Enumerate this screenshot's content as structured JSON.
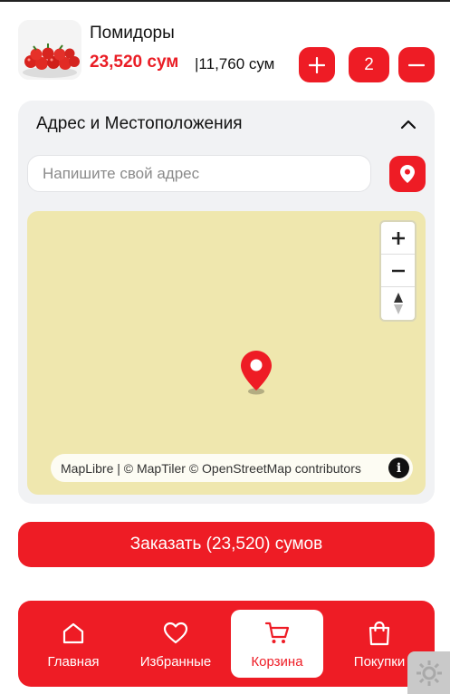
{
  "product": {
    "name": "Помидоры",
    "price": "23,520 сум",
    "unit_price": "|11,760 сум",
    "quantity": "2",
    "plus_icon": "plus-icon",
    "minus_icon": "minus-icon"
  },
  "address": {
    "title": "Адрес и Местоположения",
    "placeholder": "Напишите свой адрес",
    "collapse_icon": "chevron-up-icon",
    "location_icon": "map-pin-icon"
  },
  "map": {
    "attribution": "MapLibre | © MapTiler © OpenStreetMap contributors",
    "info": "i",
    "background": "#efe7ae"
  },
  "order": {
    "label": "Заказать (23,520) сумов"
  },
  "nav": {
    "items": [
      {
        "label": "Главная",
        "icon": "home-icon"
      },
      {
        "label": "Избранные",
        "icon": "heart-icon"
      },
      {
        "label": "Корзина",
        "icon": "cart-icon",
        "active": true
      },
      {
        "label": "Покупки",
        "icon": "shopping-bag-icon"
      }
    ]
  },
  "colors": {
    "accent": "#ee1c25",
    "panel": "#f1f2f4"
  }
}
